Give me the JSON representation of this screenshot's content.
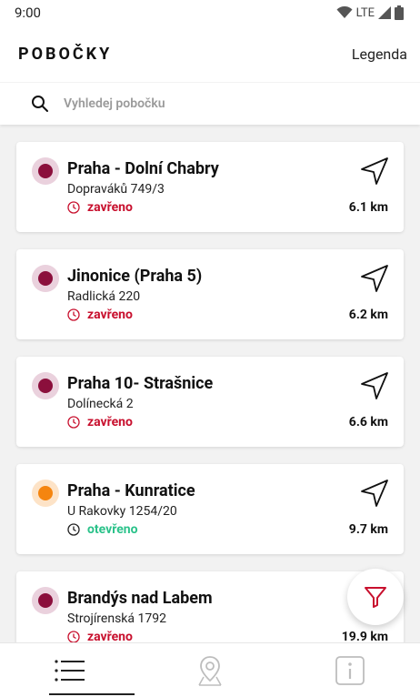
{
  "status_bar": {
    "time": "9:00",
    "network": "LTE"
  },
  "header": {
    "title": "POBOČKY",
    "legend_label": "Legenda"
  },
  "search": {
    "placeholder": "Vyhledej pobočku"
  },
  "colors": {
    "closed": "#c8102e",
    "open": "#2bc28a",
    "dot_closed": "#8b0f3c",
    "dot_closed_ring": "#ead1dd",
    "dot_open": "#f5850f",
    "dot_open_ring": "#fde3c7",
    "accent": "#c8102e"
  },
  "branches": [
    {
      "name": "Praha - Dolní Chabry",
      "address": "Dopraváků 749/3",
      "status": "zavřeno",
      "open": false,
      "distance": "6.1 km"
    },
    {
      "name": "Jinonice (Praha 5)",
      "address": "Radlická 220",
      "status": "zavřeno",
      "open": false,
      "distance": "6.2 km"
    },
    {
      "name": "Praha 10- Strašnice",
      "address": "Dolínecká 2",
      "status": "zavřeno",
      "open": false,
      "distance": "6.6 km"
    },
    {
      "name": "Praha - Kunratice",
      "address": "U Rakovky 1254/20",
      "status": "otevřeno",
      "open": true,
      "distance": "9.7 km"
    },
    {
      "name": "Brandýs nad Labem",
      "address": "Strojírenská 1792",
      "status": "zavřeno",
      "open": false,
      "distance": "19.9 km"
    }
  ],
  "bottom_nav": [
    {
      "icon": "list-icon",
      "active": true
    },
    {
      "icon": "map-pin-icon",
      "active": false
    },
    {
      "icon": "info-icon",
      "active": false
    }
  ]
}
